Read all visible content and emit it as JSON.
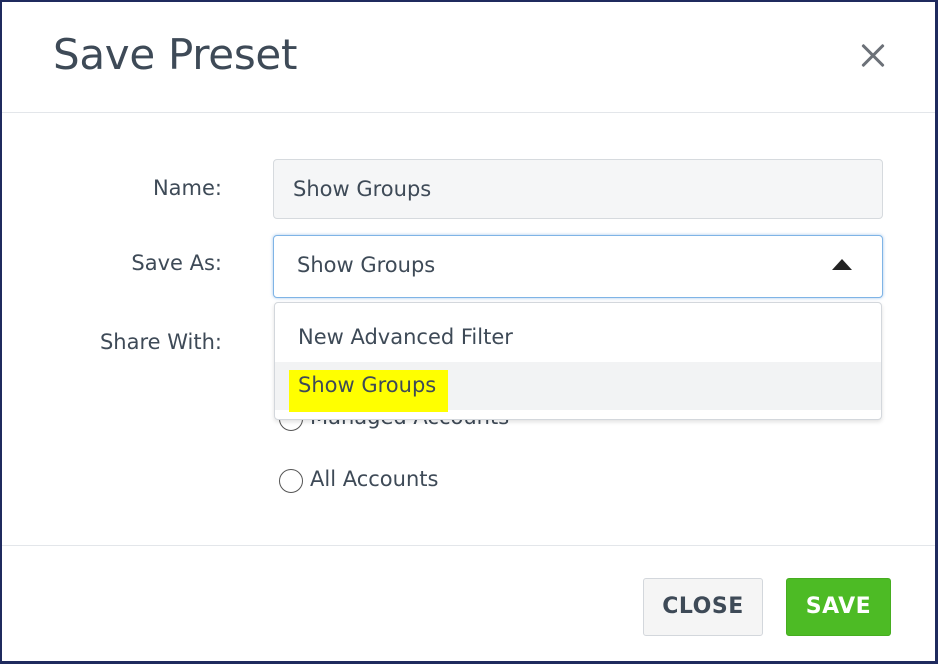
{
  "dialog": {
    "title": "Save Preset",
    "close_icon": "close-icon"
  },
  "form": {
    "name_label": "Name:",
    "name_value": "Show Groups",
    "save_as_label": "Save As:",
    "save_as_value": "Show Groups",
    "share_with_label": "Share With:"
  },
  "dropdown": {
    "options": [
      {
        "label": "New Advanced Filter",
        "highlighted": false
      },
      {
        "label": "Show Groups",
        "highlighted": true
      }
    ]
  },
  "share_options": [
    {
      "label": "Managed Accounts",
      "checked": false
    },
    {
      "label": "All Accounts",
      "checked": false
    }
  ],
  "footer": {
    "close_label": "CLOSE",
    "save_label": "SAVE"
  },
  "colors": {
    "save_button": "#4dbb25",
    "highlight": "#ffff00",
    "focus_border": "#7fb4e6",
    "text": "#3e4a57"
  }
}
